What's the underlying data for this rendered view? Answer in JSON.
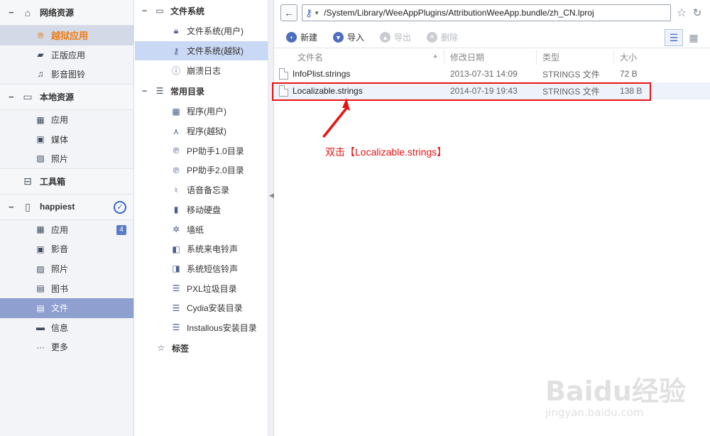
{
  "sidebar": {
    "groups": [
      {
        "label": "网络资源",
        "items": [
          "越狱应用",
          "正版应用",
          "影音图铃"
        ]
      },
      {
        "label": "本地资源",
        "items": [
          "应用",
          "媒体",
          "照片"
        ]
      },
      {
        "label": "工具箱",
        "items": []
      },
      {
        "label": "happiest",
        "items": [
          "应用",
          "影音",
          "照片",
          "图书",
          "文件",
          "信息",
          "更多"
        ],
        "app_badge": "4"
      }
    ]
  },
  "tree": {
    "filesystem_title": "文件系统",
    "filesystem_items": [
      "文件系统(用户)",
      "文件系统(越狱)",
      "崩溃日志"
    ],
    "common_title": "常用目录",
    "common_items": [
      "程序(用户)",
      "程序(越狱)",
      "PP助手1.0目录",
      "PP助手2.0目录",
      "语音备忘录",
      "移动硬盘",
      "墙纸",
      "系统来电铃声",
      "系统短信铃声",
      "PXL垃圾目录",
      "Cydia安装目录",
      "Installous安装目录"
    ],
    "tags_title": "标签"
  },
  "address": {
    "path": "/System/Library/WeeAppPlugins/AttributionWeeApp.bundle/zh_CN.lproj"
  },
  "toolbar": {
    "new": "新建",
    "import": "导入",
    "export": "导出",
    "delete": "删除"
  },
  "columns": {
    "name": "文件名",
    "date": "修改日期",
    "type": "类型",
    "size": "大小"
  },
  "files": [
    {
      "name": "InfoPlist.strings",
      "date": "2013-07-31 14:09",
      "type": "STRINGS 文件",
      "size": "72 B"
    },
    {
      "name": "Localizable.strings",
      "date": "2014-07-19 19:43",
      "type": "STRINGS 文件",
      "size": "138 B"
    }
  ],
  "annotation": "双击【Localizable.strings】",
  "watermark": {
    "brand": "Baidu经验",
    "url": "jingyan.baidu.com"
  },
  "colors": {
    "accent": "#3c66c8",
    "selected_orange": "#f07c13",
    "annotation_red": "#e61515",
    "sidebar_selected": "#8e9fd0"
  }
}
